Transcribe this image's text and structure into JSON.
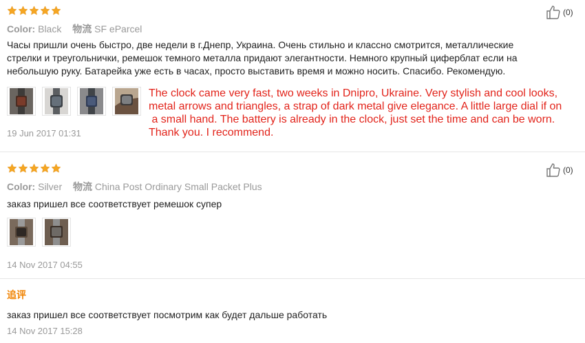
{
  "reviews": [
    {
      "rating": 5,
      "color_label": "Color:",
      "color_value": "Black",
      "shipping_label": "物流",
      "shipping_value": "SF eParcel",
      "text": "Часы пришли очень быстро, две недели в г.Днепр, Украина. Очень стильно и классно смотрится, металлические стрелки и треугольнички, ремешок темного металла придают элегантности. Немного крупный циферблат если на небольшую руку. Батарейка уже есть в часах, просто выставить время и можно носить. Спасибо. Рекомендую.",
      "text_lines": [
        "Часы пришли очень быстро, две недели в г.Днепр, Украина. Очень стильно и классно смотрится, металлические",
        "стрелки и треугольнички, ремешок темного металла придают элегантности. Немного крупный циферблат если на",
        "небольшую руку. Батарейка уже есть в часах, просто выставить время и можно носить. Спасибо. Рекомендую."
      ],
      "date": "19 Jun 2017 01:31",
      "likes": "(0)",
      "photos": [
        "watch-photo",
        "watch-photo",
        "watch-photo",
        "watch-photo"
      ]
    },
    {
      "rating": 5,
      "color_label": "Color:",
      "color_value": "Silver",
      "shipping_label": "物流",
      "shipping_value": "China Post Ordinary Small Packet Plus",
      "text": "заказ пришел все соответствует ремешок супер",
      "date": "14 Nov 2017 04:55",
      "likes": "(0)",
      "photos": [
        "watch-photo",
        "watch-photo"
      ],
      "followup": {
        "label": "追评",
        "text": "заказ пришел все соответствует посмотрим как будет дальше работать",
        "date": "14 Nov 2017 15:28"
      }
    }
  ],
  "translation": {
    "lines": [
      "The clock came very fast, two weeks in Dnipro, Ukraine. Very stylish and cool looks,",
      "metal arrows and triangles, a strap of dark metal give elegance. A little large dial if on",
      " a small hand. The battery is already in the clock, just set the time and can be worn.",
      "Thank you. I recommend."
    ]
  },
  "colors": {
    "star": "#f5a623",
    "translation": "#e2231a",
    "followup": "#f08200",
    "meta": "#999999"
  },
  "icons": {
    "star": "star-icon",
    "like": "thumbs-up-icon"
  }
}
